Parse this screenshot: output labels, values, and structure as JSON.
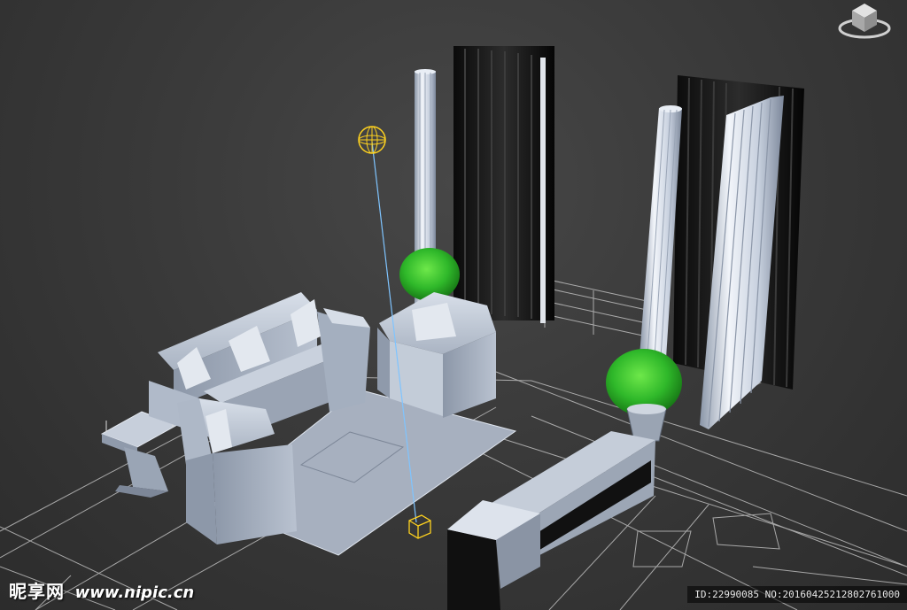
{
  "viewport": {
    "background": "#3a3a3a",
    "wire_color": "#cfcfcf",
    "light_color": "#ffd21f",
    "target_line_color": "#7fc4ff",
    "plant_color": "#2fb82a",
    "model_color": "#b8c2d0"
  },
  "viewcube": {
    "icon": "viewcube-icon"
  },
  "watermark": {
    "logo_text": "昵享网",
    "url_text": "www.nipic.cn",
    "id_text": "ID:22990085 NO:20160425212802761000"
  }
}
